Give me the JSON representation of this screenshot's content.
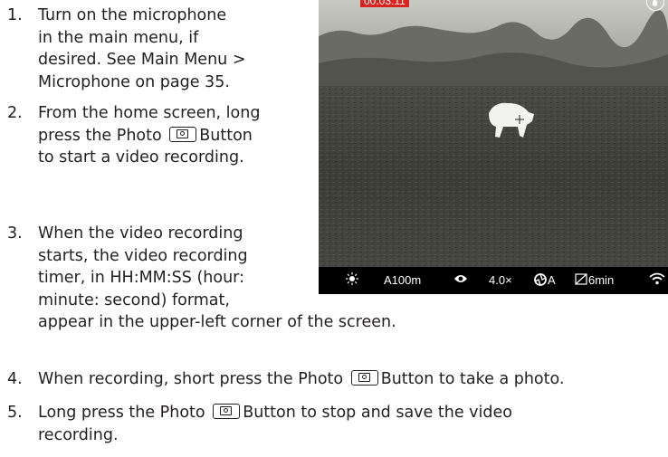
{
  "steps": [
    {
      "number": "1.",
      "lines": [
        "Turn on the microphone",
        "in the main menu, if",
        "desired. See Main Menu >",
        "Microphone on page 35."
      ]
    },
    {
      "number": "2.",
      "line1": "From the home screen, long",
      "line2_pre": "press the Photo",
      "line2_post": "Button",
      "line3": "to start a video recording."
    },
    {
      "number": "3.",
      "lines": [
        "When the video recording",
        "starts, the video recording",
        "timer, in HH:MM:SS (hour:",
        "minute: second) format,",
        "appear in the upper-left corner of the screen."
      ]
    },
    {
      "number": "4.",
      "pre": "When recording, short press the Photo",
      "post": "Button to take a photo."
    },
    {
      "number": "5.",
      "pre": "Long press the Photo",
      "post": "Button to stop and save the video",
      "line2": "recording."
    }
  ],
  "photo_button_icon": "camera-button-icon",
  "scope_view": {
    "timer": "00:03:11",
    "mic_icon": "microphone-icon",
    "status_bar": {
      "brightness_icon": "sun-icon",
      "range": "A100m",
      "eye_icon": "eye-icon",
      "zoom": "4.0×",
      "mode_icon": "aperture-icon",
      "mode": "A",
      "timeout_icon": "timer-icon",
      "timeout": "6min",
      "wifi_icon": "wifi-icon"
    }
  }
}
